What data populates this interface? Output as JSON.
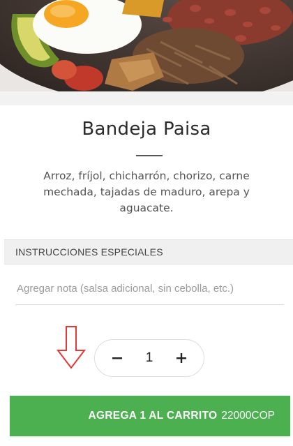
{
  "product": {
    "title": "Bandeja Paisa",
    "description": "Arroz, fríjol, chicharrón, chorizo, carne mechada, tajadas de maduro, arepa y aguacate."
  },
  "instructions": {
    "header": "INSTRUCCIONES ESPECIALES",
    "placeholder": "Agregar nota (salsa adicional, sin cebolla, etc.)",
    "value": ""
  },
  "quantity": {
    "value": "1",
    "decrement_icon": "minus-icon",
    "increment_icon": "plus-icon"
  },
  "cart_button": {
    "label": "AGREGA 1 AL CARRITO",
    "price": "22000COP"
  },
  "colors": {
    "accent": "#4caf50",
    "arrow": "#e53935"
  }
}
